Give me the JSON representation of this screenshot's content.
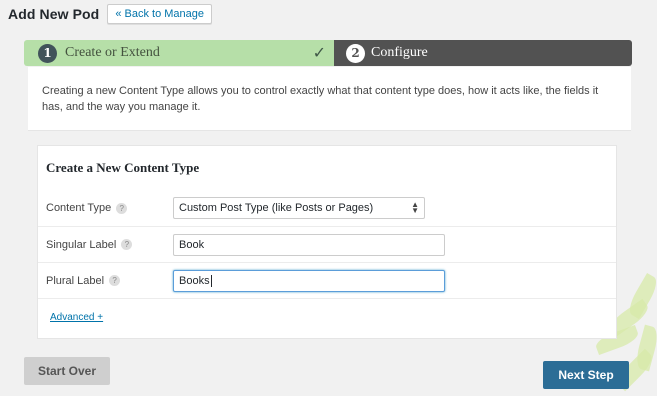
{
  "header": {
    "title": "Add New Pod",
    "back_button": "« Back to Manage"
  },
  "steps": [
    {
      "number": "1",
      "label": "Create or Extend",
      "status": "complete",
      "check_icon": "checkmark-icon"
    },
    {
      "number": "2",
      "label": "Configure",
      "status": "active"
    }
  ],
  "intro": {
    "text": "Creating a new Content Type allows you to control exactly what that content type does, how it acts like, the fields it has, and the way you manage it."
  },
  "form": {
    "heading": "Create a New Content Type",
    "help_glyph": "?",
    "content_type": {
      "label": "Content Type",
      "selected": "Custom Post Type (like Posts or Pages)"
    },
    "singular": {
      "label": "Singular Label",
      "value": "Book"
    },
    "plural": {
      "label": "Plural Label",
      "value": "Books"
    },
    "advanced_link": "Advanced +"
  },
  "footer": {
    "start_over": "Start Over",
    "next_step": "Next Step"
  },
  "colors": {
    "step_complete": "#b6dfa8",
    "step_active": "#525252",
    "link": "#0073aa",
    "primary_button": "#2c6d96"
  }
}
